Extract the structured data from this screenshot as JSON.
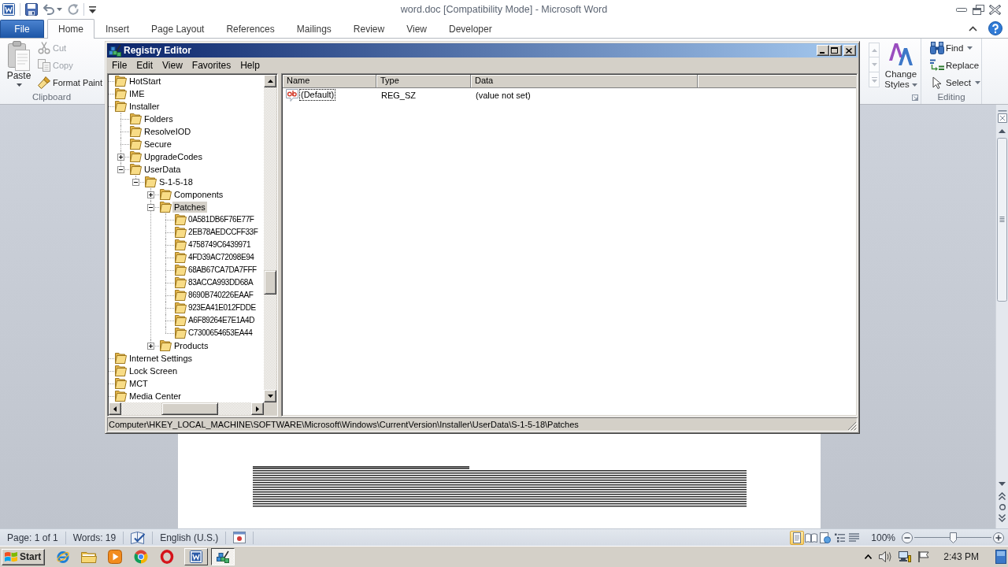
{
  "word": {
    "title": "word.doc [Compatibility Mode] - Microsoft Word",
    "tabs": [
      {
        "label": "File",
        "kind": "file",
        "selected": false
      },
      {
        "label": "Home",
        "kind": "tab",
        "selected": true
      },
      {
        "label": "Insert",
        "kind": "tab",
        "selected": false
      },
      {
        "label": "Page Layout",
        "kind": "tab",
        "selected": false
      },
      {
        "label": "References",
        "kind": "tab",
        "selected": false
      },
      {
        "label": "Mailings",
        "kind": "tab",
        "selected": false
      },
      {
        "label": "Review",
        "kind": "tab",
        "selected": false
      },
      {
        "label": "View",
        "kind": "tab",
        "selected": false
      },
      {
        "label": "Developer",
        "kind": "tab",
        "selected": false
      }
    ],
    "ribbon": {
      "clipboard": {
        "label": "Clipboard",
        "paste": {
          "label": "Paste"
        },
        "commands": [
          {
            "label": "Cut",
            "disabled": true
          },
          {
            "label": "Copy",
            "disabled": true
          },
          {
            "label": "Format Paint",
            "disabled": false
          }
        ]
      },
      "styles": {
        "change_styles": {
          "label": "Change Styles"
        }
      },
      "editing": {
        "label": "Editing",
        "commands": [
          {
            "label": "Find",
            "dropdown": true
          },
          {
            "label": "Replace",
            "dropdown": false
          },
          {
            "label": "Select",
            "dropdown": true
          }
        ]
      }
    },
    "status_bar": {
      "page": "Page: 1 of 1",
      "words": "Words: 19",
      "language": "English (U.S.)",
      "views": [
        {
          "selected": true
        },
        {
          "selected": false
        },
        {
          "selected": false
        },
        {
          "selected": false
        },
        {
          "selected": false
        }
      ],
      "zoom": "100%",
      "zoom_slider": {
        "level": 0.5
      }
    }
  },
  "registry_editor": {
    "title": "Registry Editor",
    "menu": [
      "File",
      "Edit",
      "View",
      "Favorites",
      "Help"
    ],
    "tree": [
      {
        "label": "HotStart",
        "selected": false
      },
      {
        "label": "IME",
        "selected": false
      },
      {
        "label": "Installer",
        "selected": false,
        "children": [
          {
            "label": "Folders",
            "selected": false
          },
          {
            "label": "ResolveIOD",
            "selected": false
          },
          {
            "label": "Secure",
            "selected": false
          },
          {
            "label": "UpgradeCodes",
            "selected": false,
            "expanded": false
          },
          {
            "label": "UserData",
            "selected": false,
            "expanded": true,
            "children": [
              {
                "label": "S-1-5-18",
                "selected": false,
                "expanded": true,
                "children": [
                  {
                    "label": "Components",
                    "selected": false,
                    "expanded": false
                  },
                  {
                    "label": "Patches",
                    "selected": true,
                    "expanded": true,
                    "children": [
                      {
                        "label": "0A581DB6F76E77F",
                        "selected": false
                      },
                      {
                        "label": "2EB78AEDCCFF33F",
                        "selected": false
                      },
                      {
                        "label": "4758749C6439971",
                        "selected": false
                      },
                      {
                        "label": "4FD39AC72098E94",
                        "selected": false
                      },
                      {
                        "label": "68AB67CA7DA7FFF",
                        "selected": false
                      },
                      {
                        "label": "83ACCA993DD68A",
                        "selected": false
                      },
                      {
                        "label": "8690B740226EAAF",
                        "selected": false
                      },
                      {
                        "label": "923EA41E012FDDE",
                        "selected": false
                      },
                      {
                        "label": "A6F89264E7E1A4D",
                        "selected": false
                      },
                      {
                        "label": "C7300654653EA44",
                        "selected": false
                      }
                    ]
                  },
                  {
                    "label": "Products",
                    "selected": false,
                    "expanded": false
                  }
                ]
              }
            ]
          }
        ]
      },
      {
        "label": "Internet Settings",
        "selected": false
      },
      {
        "label": "Lock Screen",
        "selected": false
      },
      {
        "label": "MCT",
        "selected": false
      },
      {
        "label": "Media Center",
        "selected": false
      }
    ],
    "values": {
      "columns": [
        "Name",
        "Type",
        "Data"
      ],
      "rows": [
        {
          "name": "(Default)",
          "type": "REG_SZ",
          "data": "(value not set)",
          "selected": false,
          "focused": true
        }
      ]
    },
    "status_bar": "Computer\\HKEY_LOCAL_MACHINE\\SOFTWARE\\Microsoft\\Windows\\CurrentVersion\\Installer\\UserData\\S-1-5-18\\Patches"
  },
  "taskbar": {
    "start": "Start",
    "apps": [
      {
        "running": false,
        "selected": false
      },
      {
        "running": false,
        "selected": false
      },
      {
        "running": false,
        "selected": false
      },
      {
        "running": false,
        "selected": false
      },
      {
        "running": false,
        "selected": false
      },
      {
        "running": true,
        "selected": false
      },
      {
        "running": true,
        "selected": true
      }
    ],
    "clock": "2:43 PM"
  }
}
